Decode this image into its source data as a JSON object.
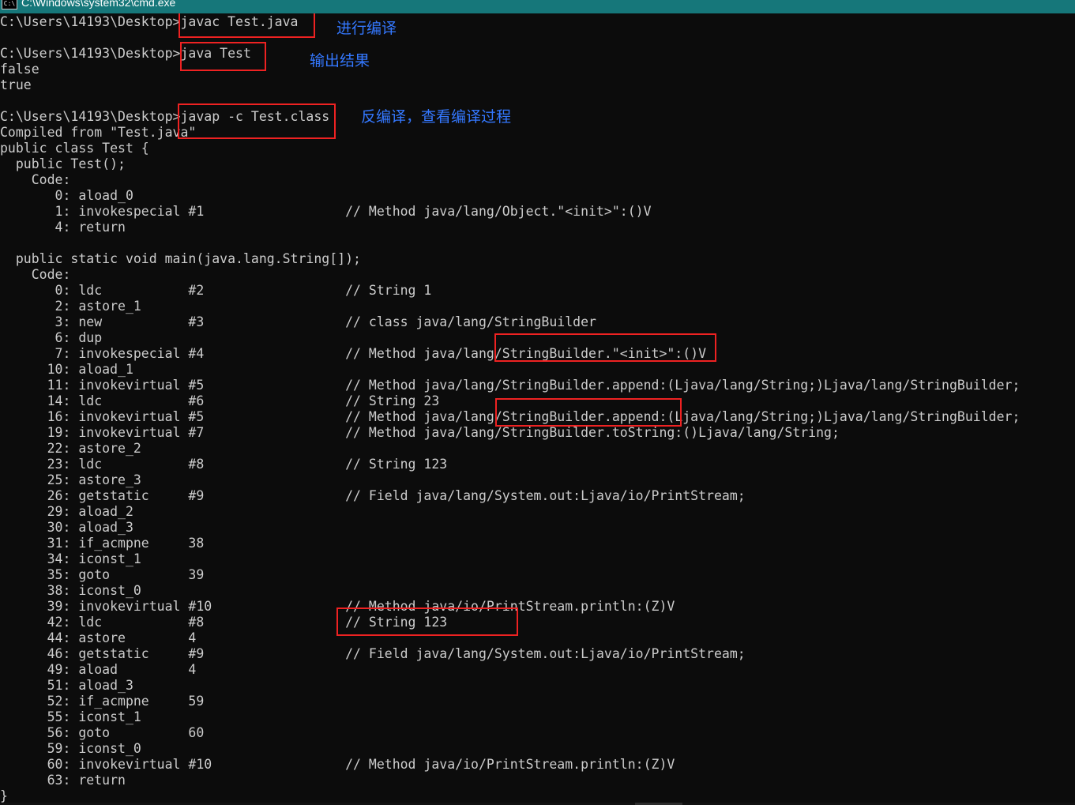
{
  "window": {
    "title": "C:\\Windows\\system32\\cmd.exe",
    "icon": "C:\\"
  },
  "console_lines": [
    "C:\\Users\\14193\\Desktop>javac Test.java",
    "",
    "C:\\Users\\14193\\Desktop>java Test",
    "false",
    "true",
    "",
    "C:\\Users\\14193\\Desktop>javap -c Test.class",
    "Compiled from \"Test.java\"",
    "public class Test {",
    "  public Test();",
    "    Code:",
    "       0: aload_0",
    "       1: invokespecial #1                  // Method java/lang/Object.\"<init>\":()V",
    "       4: return",
    "",
    "  public static void main(java.lang.String[]);",
    "    Code:",
    "       0: ldc           #2                  // String 1",
    "       2: astore_1",
    "       3: new           #3                  // class java/lang/StringBuilder",
    "       6: dup",
    "       7: invokespecial #4                  // Method java/lang/StringBuilder.\"<init>\":()V",
    "      10: aload_1",
    "      11: invokevirtual #5                  // Method java/lang/StringBuilder.append:(Ljava/lang/String;)Ljava/lang/StringBuilder;",
    "      14: ldc           #6                  // String 23",
    "      16: invokevirtual #5                  // Method java/lang/StringBuilder.append:(Ljava/lang/String;)Ljava/lang/StringBuilder;",
    "      19: invokevirtual #7                  // Method java/lang/StringBuilder.toString:()Ljava/lang/String;",
    "      22: astore_2",
    "      23: ldc           #8                  // String 123",
    "      25: astore_3",
    "      26: getstatic     #9                  // Field java/lang/System.out:Ljava/io/PrintStream;",
    "      29: aload_2",
    "      30: aload_3",
    "      31: if_acmpne     38",
    "      34: iconst_1",
    "      35: goto          39",
    "      38: iconst_0",
    "      39: invokevirtual #10                 // Method java/io/PrintStream.println:(Z)V",
    "      42: ldc           #8                  // String 123",
    "      44: astore        4",
    "      46: getstatic     #9                  // Field java/lang/System.out:Ljava/io/PrintStream;",
    "      49: aload         4",
    "      51: aload_3",
    "      52: if_acmpne     59",
    "      55: iconst_1",
    "      56: goto          60",
    "      59: iconst_0",
    "      60: invokevirtual #10                 // Method java/io/PrintStream.println:(Z)V",
    "      63: return",
    "}"
  ],
  "annotations": {
    "compile": "进行编译",
    "run_output": "输出结果",
    "decompile": "反编译，查看编译过程"
  },
  "colors": {
    "background": "#0c0c0c",
    "text": "#cccccc",
    "annotation": "#3478ff",
    "highlight_box": "#ee2222",
    "titlebar": "#16777a"
  }
}
